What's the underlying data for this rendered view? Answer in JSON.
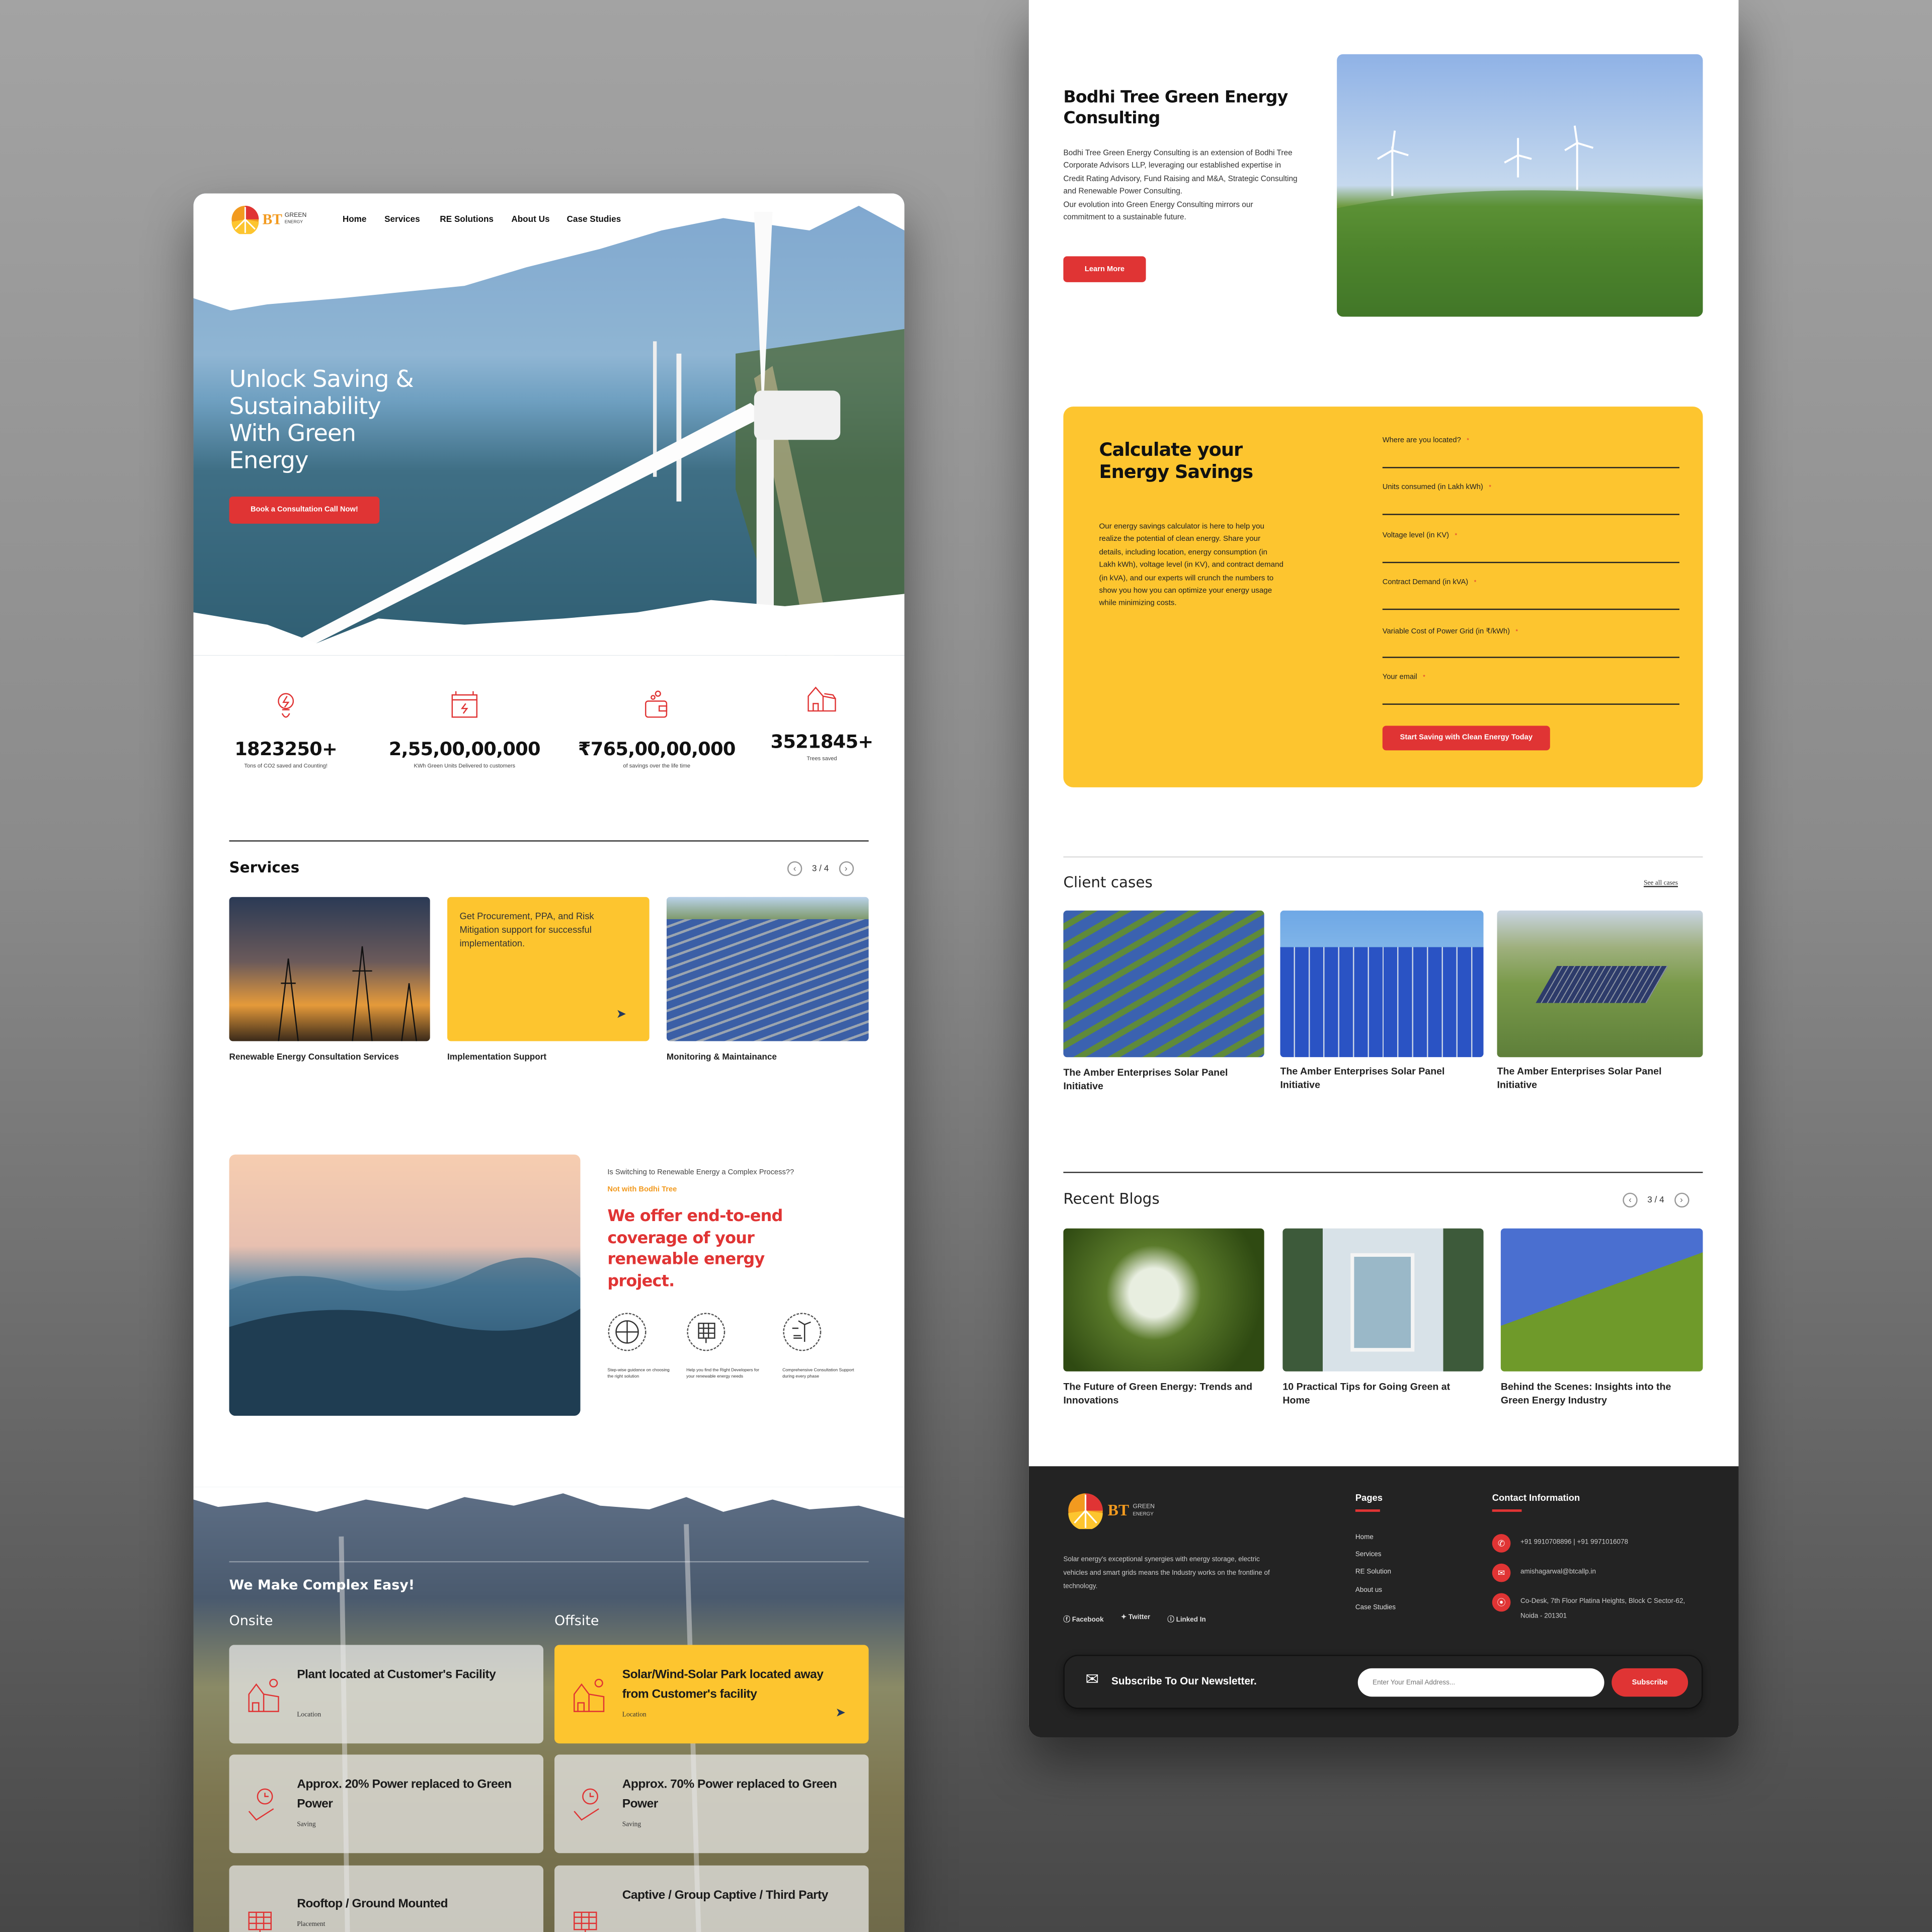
{
  "brand": {
    "logo_text": "BT",
    "logo_sub1": "GREEN",
    "logo_sub2": "ENERGY"
  },
  "nav": {
    "items": [
      "Home",
      "Services",
      "RE Solutions",
      "About Us",
      "Case Studies"
    ]
  },
  "hero": {
    "headline_lines": [
      "Unlock Saving &",
      "Sustainability",
      "With Green",
      "Energy"
    ],
    "cta": "Book a Consultation Call Now!"
  },
  "stats": [
    {
      "icon": "bulb-leaf-icon",
      "value": "1823250+",
      "label": "Tons of CO2 saved and Counting!"
    },
    {
      "icon": "battery-icon",
      "value": "2,55,00,00,000",
      "label": "KWh Green Units Delivered to customers"
    },
    {
      "icon": "wallet-coins-icon",
      "value": "₹765,00,00,000",
      "label": "of savings over the life time"
    },
    {
      "icon": "solar-house-icon",
      "value": "3521845+",
      "label": "Trees saved"
    }
  ],
  "services": {
    "title": "Services",
    "pager": "3 / 4",
    "cards": [
      {
        "label": "Renewable Energy Consultation Services"
      },
      {
        "label": "Implementation Support",
        "overlay": "Get Procurement, PPA, and Risk Mitigation support for successful implementation."
      },
      {
        "label": "Monitoring & Maintainance"
      }
    ]
  },
  "process": {
    "question": "Is Switching to Renewable Energy a Complex Process??",
    "tagline": "Not with Bodhi Tree",
    "headline": "We offer end-to-end coverage of your renewable energy project.",
    "features": [
      {
        "icon": "analysis-chart-icon",
        "text": "Step-wise guidance on choosing the right solution"
      },
      {
        "icon": "solar-panel-grid-icon",
        "text": "Help you find the Right Developers for your renewable energy needs"
      },
      {
        "icon": "wind-solar-icon",
        "text": "Comprehensive Consultation Support during every phase"
      }
    ]
  },
  "easy": {
    "title": "We Make Complex Easy!",
    "onsite": "Onsite",
    "offsite": "Offsite",
    "rows": [
      {
        "onsite": "Plant located at Customer's Facility",
        "offsite": "Solar/Wind-Solar Park located away from Customer's facility",
        "sub": "Location",
        "icon": "solar-house-icon"
      },
      {
        "onsite": "Approx. 20% Power replaced to Green Power",
        "offsite": "Approx. 70% Power replaced to Green Power",
        "sub": "Saving",
        "icon": "hand-clock-icon"
      },
      {
        "onsite": "Rooftop / Ground Mounted",
        "offsite": "Captive / Group Captive / Third Party",
        "sub": "Placement",
        "icon": "solar-panel-icon"
      }
    ]
  },
  "consulting": {
    "title": "Bodhi Tree Green Energy Consulting",
    "body": "Bodhi Tree Green Energy Consulting is an extension of Bodhi Tree Corporate Advisors LLP, leveraging our established expertise in Credit Rating Advisory, Fund Raising and M&A, Strategic Consulting and Renewable Power Consulting.",
    "body2": "Our evolution into Green Energy Consulting mirrors our commitment to a sustainable future.",
    "cta": "Learn More"
  },
  "calculator": {
    "title": "Calculate your Energy Savings",
    "body": "Our energy savings calculator is here to help you realize the potential of clean energy. Share your details, including location, energy consumption (in Lakh kWh), voltage level (in KV), and contract demand (in kVA), and our experts will crunch the numbers to show you how you can optimize your energy usage while minimizing costs.",
    "fields": [
      {
        "label": "Where are you located?",
        "value": ""
      },
      {
        "label": "Units consumed (in Lakh kWh)",
        "value": ""
      },
      {
        "label": "Voltage level (in KV)",
        "value": ""
      },
      {
        "label": "Contract Demand (in kVA)",
        "value": ""
      },
      {
        "label": "Variable Cost of Power Grid (in ₹/kWh)",
        "value": ""
      },
      {
        "label": "Your email",
        "value": ""
      }
    ],
    "required_mark": "*",
    "cta": "Start Saving with Clean Energy Today"
  },
  "cases": {
    "title": "Client cases",
    "see_all": "See all cases",
    "items": [
      "The Amber Enterprises Solar Panel Initiative",
      "The Amber Enterprises Solar Panel Initiative",
      "The Amber Enterprises Solar Panel Initiative"
    ]
  },
  "blogs": {
    "title": "Recent Blogs",
    "pager": "3 / 4",
    "items": [
      "The Future of Green Energy: Trends and Innovations",
      "10 Practical Tips for Going Green at Home",
      "Behind the Scenes: Insights into the Green Energy Industry"
    ]
  },
  "footer": {
    "about": "Solar energy's exceptional synergies with energy storage, electric vehicles and smart grids means the Industry works on the frontline of technology.",
    "socials": [
      "Facebook",
      "Twitter",
      "Linked In"
    ],
    "pages_title": "Pages",
    "pages": [
      "Home",
      "Services",
      "RE Solution",
      "About us",
      "Case Studies"
    ],
    "contact_title": "Contact Information",
    "phone": "+91 9910708896 | +91 9971016078",
    "email": "amishagarwal@btcallp.in",
    "address": "Co-Desk, 7th Floor Platina Heights, Block C Sector-62, Noida - 201301",
    "newsletter": {
      "title": "Subscribe To Our Newsletter.",
      "placeholder": "Enter Your Email Address...",
      "button": "Subscribe"
    }
  },
  "colors": {
    "accent_red": "#e03434",
    "accent_yellow": "#fdc52f",
    "footer_bg": "#232323"
  }
}
